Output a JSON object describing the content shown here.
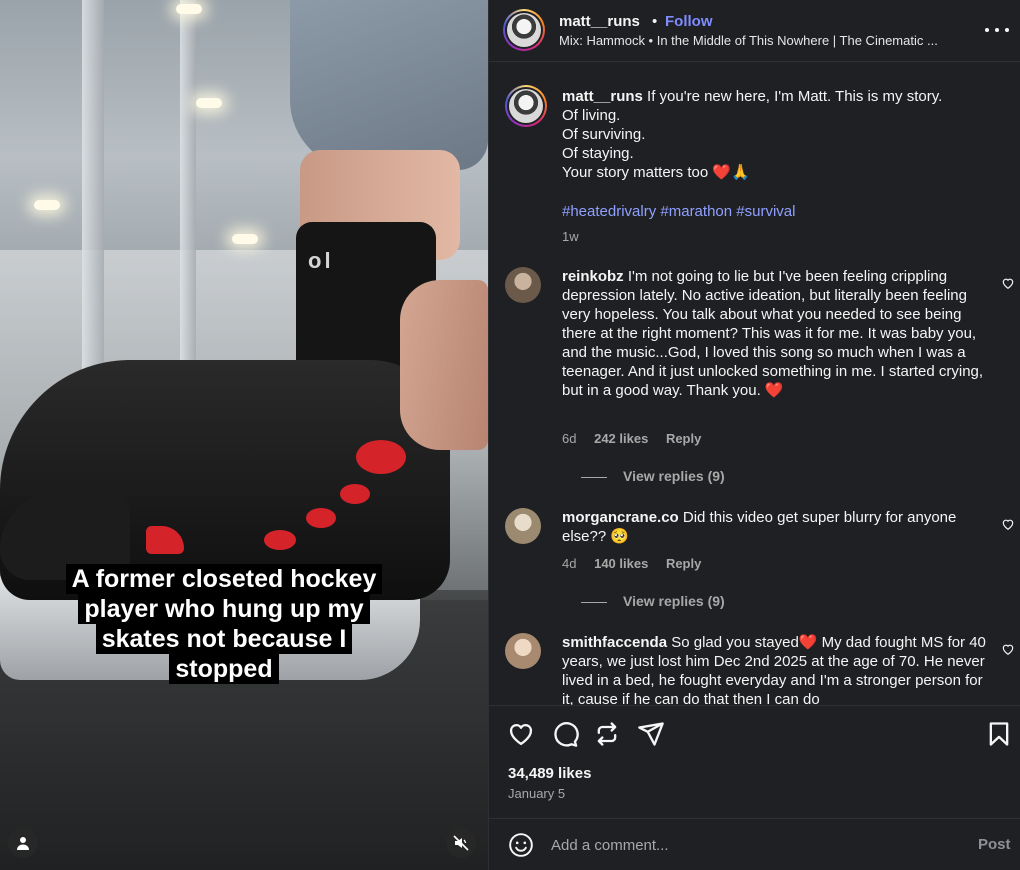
{
  "header": {
    "username": "matt__runs",
    "separator": "•",
    "follow_label": "Follow",
    "audio": "Mix: Hammock • In the Middle of This Nowhere | The Cinematic ..."
  },
  "video": {
    "caption_overlay": "A former closeted hockey player who hung up my skates not because I stopped",
    "sock_text": "ol"
  },
  "post_caption": {
    "username": "matt__runs",
    "lines": [
      " If you're new here, I'm Matt. This is my story.",
      "Of living.",
      "Of surviving.",
      "Of staying.",
      "Your story matters too ❤️🙏"
    ],
    "hashtags": "#heatedrivalry #marathon #survival",
    "time": "1w"
  },
  "comments": [
    {
      "username": "reinkobz",
      "text": " I'm not going to lie but I've been feeling crippling depression lately. No active ideation, but literally been feeling very hopeless. You talk about what you needed to see being there at the right moment? This was it for me. It was baby you, and the music...God, I loved this song so much when I was a teenager. And it just unlocked something in me. I started crying, but in a good way. Thank you. ❤️",
      "time": "6d",
      "likes": "242 likes",
      "reply": "Reply",
      "view_replies": "View replies (9)",
      "avatar_color": "#6b5a4a"
    },
    {
      "username": "morgancrane.co",
      "text": " Did this video get super blurry for anyone else?? 🥺",
      "time": "4d",
      "likes": "140 likes",
      "reply": "Reply",
      "view_replies": "View replies (9)",
      "avatar_color": "#b7a88f"
    },
    {
      "username": "smithfaccenda",
      "text": " So glad you stayed❤️ My dad fought MS for 40 years, we just lost him Dec 2nd 2025 at the age of 70. He never lived in a bed, he fought everyday and I'm a stronger person for it, cause if he can do that then I can do",
      "avatar_color": "#c9a98c"
    }
  ],
  "actions": {
    "likes": "34,489 likes",
    "date": "January 5"
  },
  "comment_box": {
    "placeholder": "Add a comment...",
    "post_label": "Post"
  },
  "colors": {
    "panel_bg": "#1f2024",
    "link_blue": "#7d8cff",
    "hashtag": "#8fa0ff",
    "heart_red": "#ff3040"
  }
}
